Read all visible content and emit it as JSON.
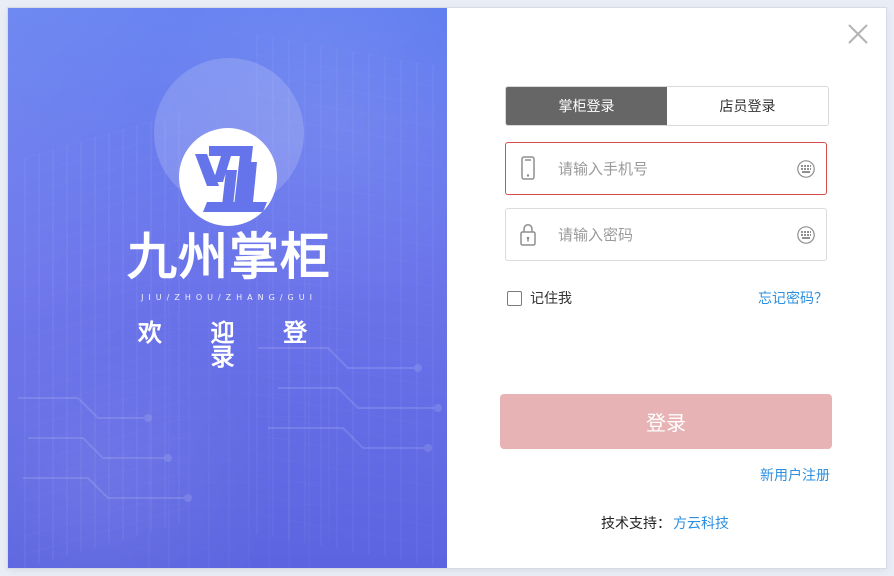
{
  "brand": {
    "title": "九州掌柜",
    "subtitle": "JIU/ZHOU/ZHANG/GUI",
    "welcome": "欢 迎 登 录"
  },
  "tabs": [
    {
      "label": "掌柜登录",
      "active": true
    },
    {
      "label": "店员登录",
      "active": false
    }
  ],
  "fields": {
    "phone": {
      "placeholder": "请输入手机号",
      "value": ""
    },
    "password": {
      "placeholder": "请输入密码",
      "value": ""
    }
  },
  "remember": {
    "label": "记住我",
    "checked": false
  },
  "links": {
    "forgot_password": "忘记密码？",
    "register": "新用户注册",
    "support_link": "方云科技"
  },
  "buttons": {
    "login": "登录"
  },
  "footer": {
    "support_label": "技术支持："
  },
  "colors": {
    "left_gradient_top": "#5f7cf0",
    "left_gradient_bottom": "#5c64e0",
    "active_tab": "#666666",
    "phone_border": "#d94c4c",
    "login_button": "#e7b3b5",
    "link": "#2d8fe0"
  },
  "icons": {
    "close": "close-icon",
    "phone": "phone-icon",
    "lock": "lock-icon",
    "keyboard": "keyboard-icon",
    "logo": "jiuzhou-logo-icon"
  }
}
